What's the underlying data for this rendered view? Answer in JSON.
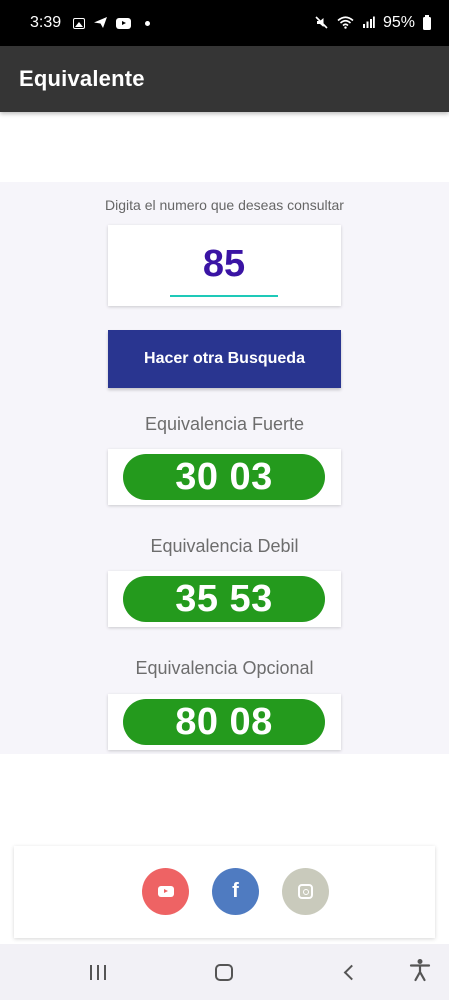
{
  "status_bar": {
    "time": "3:39",
    "battery": "95%",
    "icons": [
      "image-icon",
      "send-icon",
      "youtube-icon",
      "dot-icon",
      "mute-icon",
      "wifi-icon",
      "signal-icon",
      "battery-icon"
    ]
  },
  "app_bar": {
    "title": "Equivalente",
    "background": "#353535"
  },
  "search": {
    "prompt": "Digita el numero que deseas consultar",
    "value": "85",
    "underline_color": "#1ec9b8",
    "button_label": "Hacer otra Busqueda",
    "button_color": "#293590"
  },
  "results": [
    {
      "label": "Equivalencia Fuerte",
      "value": "30 03"
    },
    {
      "label": "Equivalencia Debil",
      "value": "35 53"
    },
    {
      "label": "Equivalencia Opcional",
      "value": "80 08"
    }
  ],
  "result_pill_color": "#249a1d",
  "social": [
    {
      "icon": "youtube-icon",
      "color": "#ee6364"
    },
    {
      "icon": "facebook-icon",
      "color": "#4f7bc1",
      "glyph": "f"
    },
    {
      "icon": "instagram-icon",
      "color": "#c9cabc"
    }
  ],
  "nav_bar": {
    "icons": [
      "recents-icon",
      "home-icon",
      "back-icon",
      "accessibility-icon"
    ]
  }
}
